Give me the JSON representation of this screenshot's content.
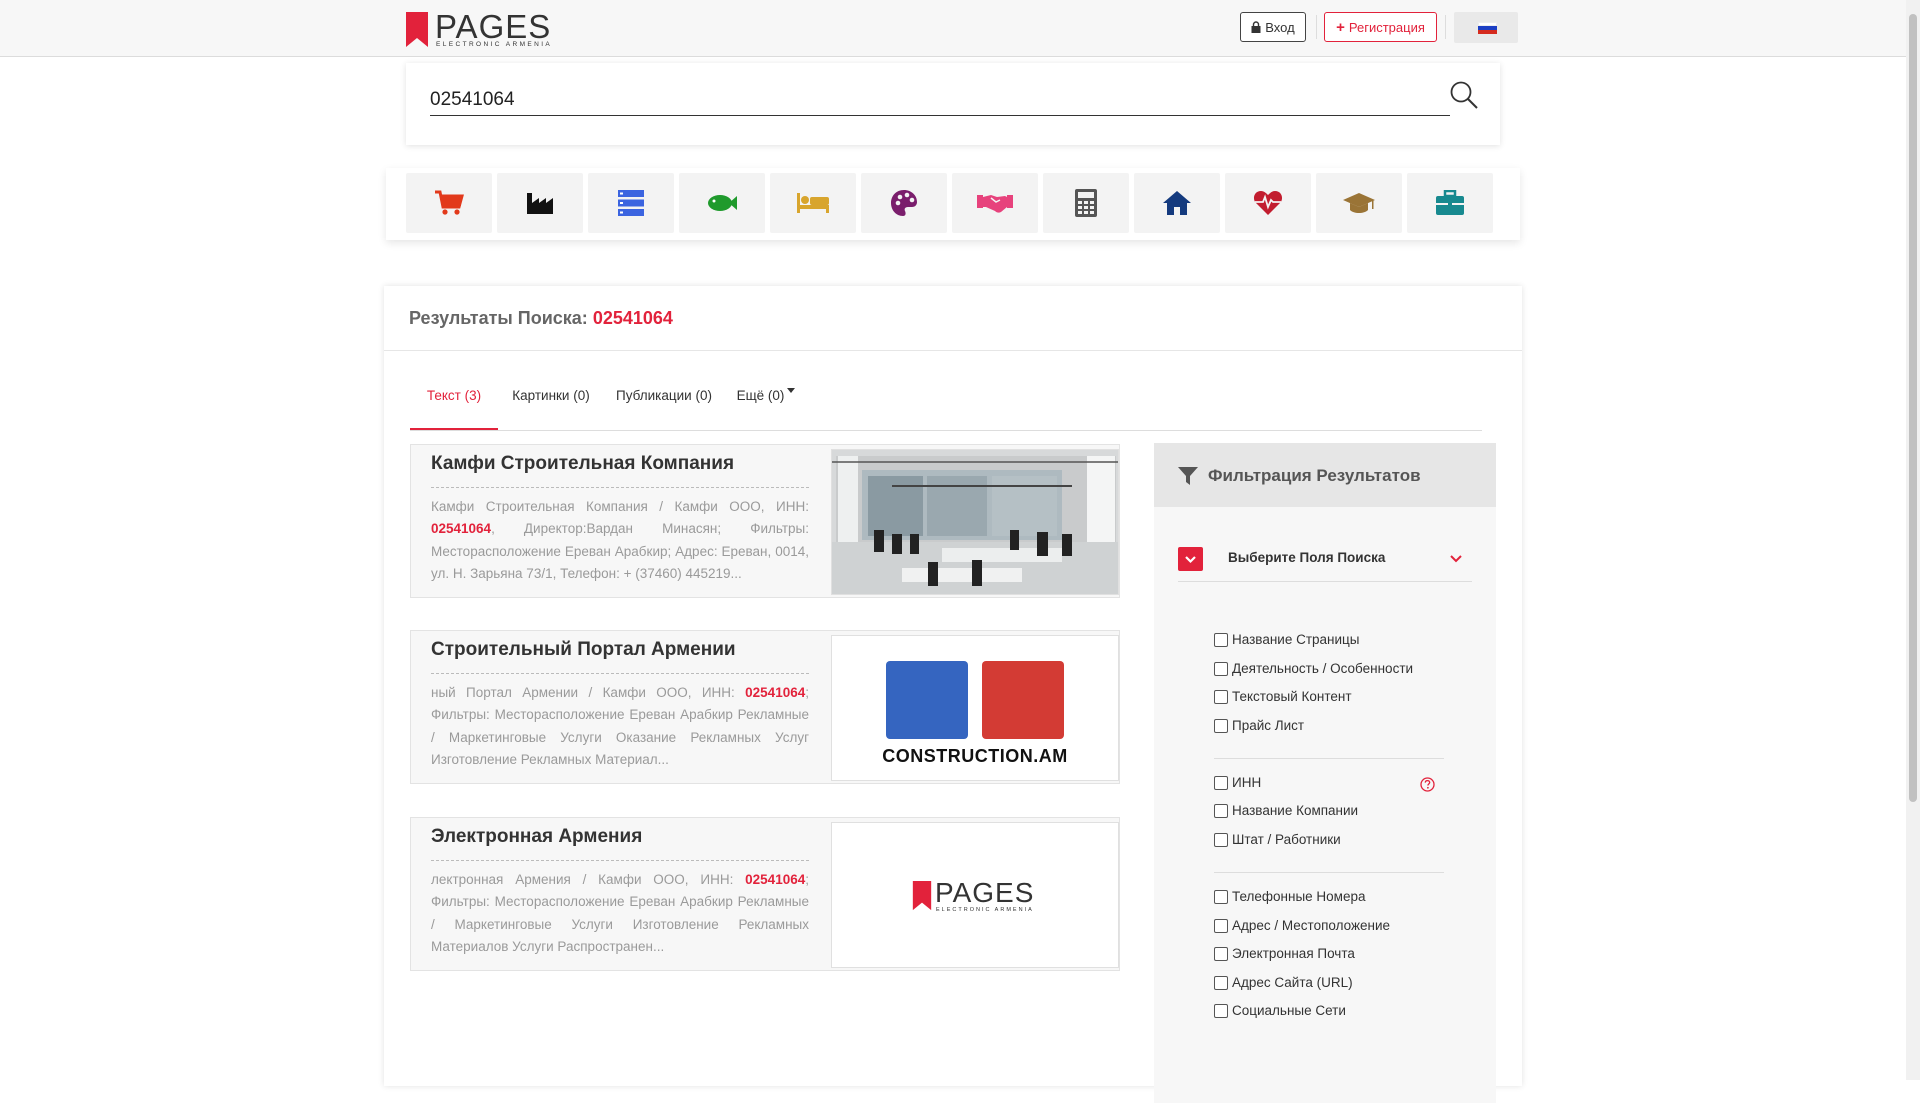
{
  "header": {
    "logo_text": "PAGES",
    "logo_sub": "ELECTRONIC ARMENIA",
    "login_label": "Вход",
    "register_label": "Регистрация",
    "language": "ru"
  },
  "search": {
    "value": "02541064"
  },
  "categories": [
    {
      "icon": "shopping-cart-icon",
      "color": "#e2391b"
    },
    {
      "icon": "industry-icon",
      "color": "#111111"
    },
    {
      "icon": "server-icon",
      "color": "#3b64e0"
    },
    {
      "icon": "fish-icon",
      "color": "#1f9a2c"
    },
    {
      "icon": "bed-icon",
      "color": "#d8a52d"
    },
    {
      "icon": "palette-icon",
      "color": "#7a1e6c"
    },
    {
      "icon": "handshake-icon",
      "color": "#e7427c"
    },
    {
      "icon": "calculator-icon",
      "color": "#555555"
    },
    {
      "icon": "home-icon",
      "color": "#143a7e"
    },
    {
      "icon": "heartbeat-icon",
      "color": "#c21d2f"
    },
    {
      "icon": "graduation-cap-icon",
      "color": "#9a7436"
    },
    {
      "icon": "briefcase-icon",
      "color": "#17898f"
    }
  ],
  "results": {
    "title_prefix": "Результаты Поиска:",
    "query": "02541064",
    "tabs": [
      {
        "label": "Текст (3)",
        "active": true
      },
      {
        "label": "Картинки (0)",
        "active": false
      },
      {
        "label": "Публикации (0)",
        "active": false
      },
      {
        "label": "Ещё (0)",
        "active": false
      }
    ],
    "items": [
      {
        "title": "Камфи Строительная Компания",
        "text_before": "Камфи Строительная Компания / Камфи ООО, ИНН: ",
        "highlight": "02541064",
        "text_after": ", Директор:Вардан Минасян; Фильтры: Месторасположение Ереван Арабкир; Адрес: Ереван, 0014, ул. Н. Зарьяна 73/1, Телефон: + (37460) 445219...",
        "image": "office-photo"
      },
      {
        "title": "Строительный Портал Армении",
        "text_before": "ный Портал Армении / Камфи ООО, ИНН: ",
        "highlight": "02541064",
        "text_after": "; Фильтры: Месторасположение Ереван Арабкир Рекламные / Маркетинговые Услуги Оказание Рекламных Услуг Изготовление Рекламных Материал...",
        "image": "construction-logo",
        "image_caption": "CONSTRUCTION.AM"
      },
      {
        "title": "Электронная Армения",
        "text_before": "лектронная Армения / Камфи ООО, ИНН: ",
        "highlight": "02541064",
        "text_after": "; Фильтры: Месторасположение Ереван Арабкир Рекламные / Маркетинговые Услуги Изготовление Рекламных Материалов Услуги Распространен...",
        "image": "pages-logo",
        "image_logo_text": "PAGES",
        "image_logo_sub": "ELECTRONIC ARMENIA"
      }
    ]
  },
  "filter": {
    "title": "Фильтрация Результатов",
    "select_label": "Выберите Поля Поиска",
    "groups": [
      [
        "Название Страницы",
        "Деятельность / Особенности",
        "Текстовый Контент",
        "Прайс Лист"
      ],
      [
        "ИНН",
        "Название Компании",
        "Штат / Работники"
      ],
      [
        "Телефонные Номера",
        "Адрес / Местоположение",
        "Электронная Почта",
        "Адрес Сайта (URL)",
        "Социальные Сети"
      ]
    ]
  }
}
